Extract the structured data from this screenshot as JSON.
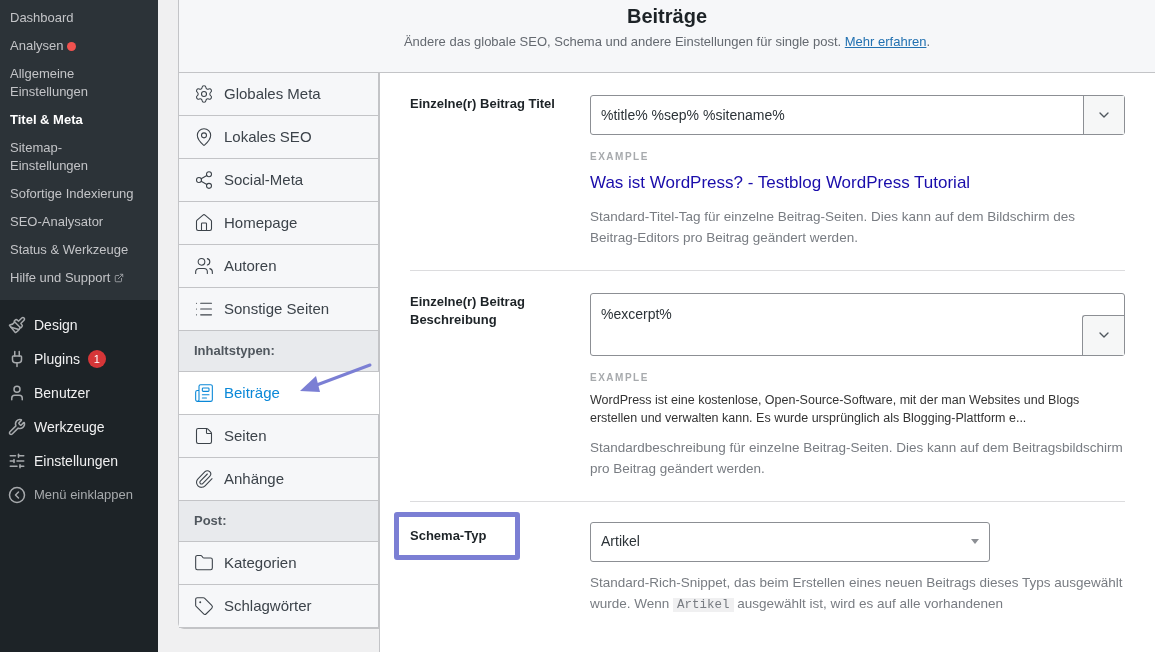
{
  "admin_menu": {
    "submenu": [
      {
        "label": "Dashboard",
        "selected": false,
        "dot": false,
        "external": false
      },
      {
        "label": "Analysen",
        "selected": false,
        "dot": true,
        "external": false
      },
      {
        "label": "Allgemeine Einstellungen",
        "selected": false,
        "dot": false,
        "external": false
      },
      {
        "label": "Titel & Meta",
        "selected": true,
        "dot": false,
        "external": false
      },
      {
        "label": "Sitemap-Einstellungen",
        "selected": false,
        "dot": false,
        "external": false
      },
      {
        "label": "Sofortige Indexierung",
        "selected": false,
        "dot": false,
        "external": false
      },
      {
        "label": "SEO-Analysator",
        "selected": false,
        "dot": false,
        "external": false
      },
      {
        "label": "Status & Werkzeuge",
        "selected": false,
        "dot": false,
        "external": false
      },
      {
        "label": "Hilfe und Support",
        "selected": false,
        "dot": false,
        "external": true
      }
    ],
    "items": [
      {
        "label": "Design"
      },
      {
        "label": "Plugins",
        "badge": "1"
      },
      {
        "label": "Benutzer"
      },
      {
        "label": "Werkzeuge"
      },
      {
        "label": "Einstellungen"
      }
    ],
    "collapse": "Menü einklappen"
  },
  "header": {
    "title": "Beiträge",
    "subtitle": "Ändere das globale SEO, Schema und andere Einstellungen für single post.",
    "link": "Mehr erfahren",
    "link_suffix": "."
  },
  "tabs": [
    {
      "kind": "tab",
      "label": "Globales Meta",
      "selected": false
    },
    {
      "kind": "tab",
      "label": "Lokales SEO",
      "selected": false
    },
    {
      "kind": "tab",
      "label": "Social-Meta",
      "selected": false
    },
    {
      "kind": "tab",
      "label": "Homepage",
      "selected": false
    },
    {
      "kind": "tab",
      "label": "Autoren",
      "selected": false
    },
    {
      "kind": "tab",
      "label": "Sonstige Seiten",
      "selected": false
    },
    {
      "kind": "heading",
      "label": "Inhaltstypen:"
    },
    {
      "kind": "tab",
      "label": "Beiträge",
      "selected": true
    },
    {
      "kind": "tab",
      "label": "Seiten",
      "selected": false
    },
    {
      "kind": "tab",
      "label": "Anhänge",
      "selected": false
    },
    {
      "kind": "heading",
      "label": "Post:"
    },
    {
      "kind": "tab",
      "label": "Kategorien",
      "selected": false
    },
    {
      "kind": "tab",
      "label": "Schlagwörter",
      "selected": false
    }
  ],
  "settings": [
    {
      "kind": "input",
      "label": "Einzelne(r) Beitrag Titel",
      "value": "%title% %sep% %sitename%",
      "example_label": "EXAMPLE",
      "example": "Was ist WordPress? - Testblog WordPress Tutorial",
      "help": "Standard-Titel-Tag für einzelne Beitrag-Seiten. Dies kann auf dem Bildschirm des Beitrag-Editors pro Beitrag geändert werden."
    },
    {
      "kind": "textarea",
      "label": "Einzelne(r) Beitrag Beschreibung",
      "value": "%excerpt%",
      "example_label": "EXAMPLE",
      "example": "WordPress ist eine kostenlose, Open-Source-Software, mit der man Websites und Blogs erstellen und verwalten kann. Es wurde ursprünglich als Blogging-Plattform e...",
      "help": "Standardbeschreibung für einzelne Beitrag-Seiten. Dies kann auf dem Beitragsbildschirm pro Beitrag geändert werden."
    },
    {
      "kind": "select",
      "label": "Schema-Typ",
      "highlighted": true,
      "value": "Artikel",
      "help_before": "Standard-Rich-Snippet, das beim Erstellen eines neuen Beitrags dieses Typs ausgewählt wurde. Wenn",
      "help_code": "Artikel",
      "help_after": "ausgewählt ist, wird es auf alle vorhandenen"
    }
  ]
}
